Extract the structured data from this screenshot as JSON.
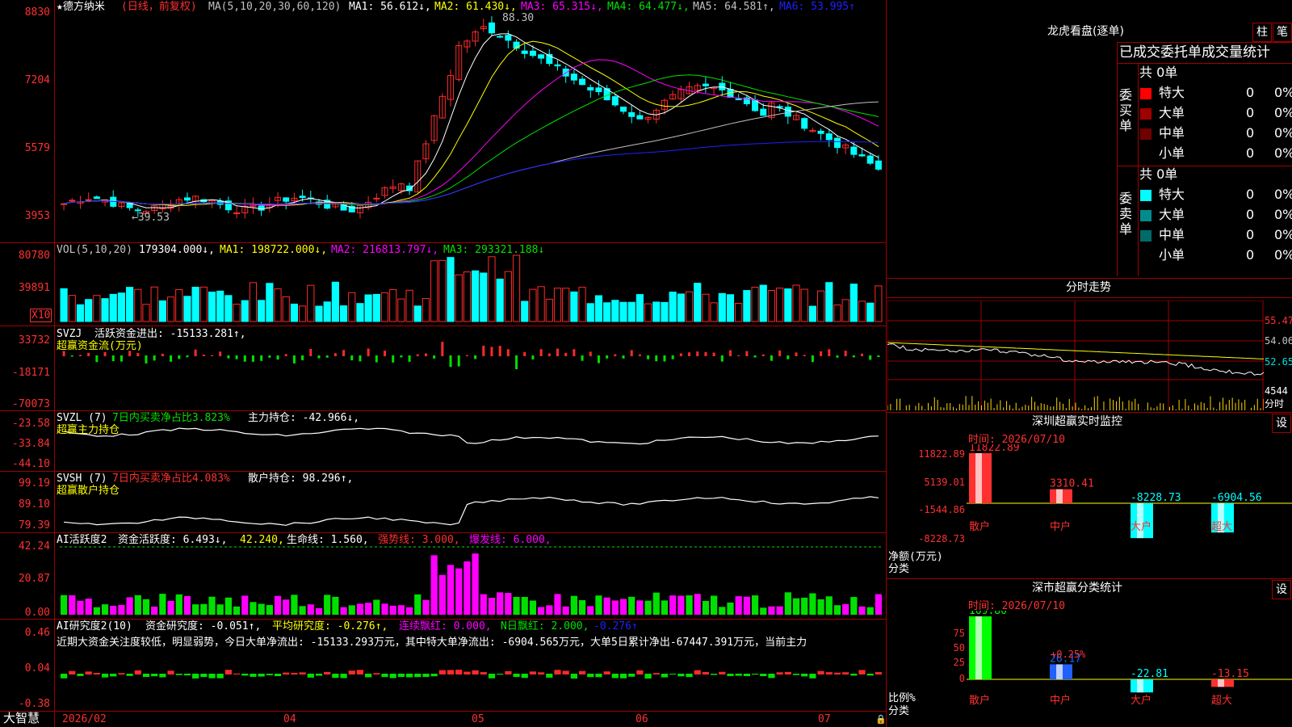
{
  "colors": {
    "up": "#ff2a2a",
    "down": "#00ffff",
    "green": "#00e000",
    "magenta": "#ff00ff",
    "yellow": "#ffff00",
    "white": "#ffffff",
    "blue": "#2020ff",
    "grid": "#a00000"
  },
  "chart": {
    "title": "★德方纳米",
    "period": "(日线，前复权)",
    "ma_label": "MA(5,10,20,30,60,120)",
    "ma1": "MA1: 56.612↓,",
    "ma2": "MA2: 61.430↓,",
    "ma3": "MA3: 65.315↓,",
    "ma4": "MA4: 64.477↓,",
    "ma5": "MA5: 64.581↑,",
    "ma6": "MA6: 53.995↑",
    "max_label": "88.30",
    "min_label": "←39.53",
    "price_ticks": [
      "8830",
      "7204",
      "5579",
      "3953"
    ],
    "vol": {
      "label": "VOL(5,10,20)",
      "v": "179304.000↓,",
      "ma1": "MA1: 198722.000↓,",
      "ma2": "MA2: 216813.797↓,",
      "ma3": "MA3: 293321.188↓",
      "ticks": [
        "80780",
        "39891"
      ],
      "x10": "X10"
    },
    "svzj": {
      "label": "SVZJ",
      "text": "活跃资金进出: -15133.281↑,",
      "sub": "超赢资金流(万元)",
      "ticks": [
        "33732",
        "-18171",
        "-70073"
      ]
    },
    "svzl": {
      "label": "SVZL (7)",
      "pct": "7日内买卖净占比3.823%",
      "hold": "主力持仓: -42.966↓,",
      "sub": "超赢主力持仓",
      "ticks": [
        "-23.58",
        "-33.84",
        "-44.10"
      ]
    },
    "svsh": {
      "label": "SVSH (7)",
      "pct": "7日内买卖净占比4.083%",
      "hold": "散户持仓: 98.296↑,",
      "sub": "超赢散户持仓",
      "ticks": [
        "99.19",
        "89.10",
        "79.39"
      ]
    },
    "ai1": {
      "label": "AI活跃度2",
      "a": "资金活跃度: 6.493↓,",
      "b": "42.240,",
      "c": "生命线: 1.560,",
      "d": "强势线: 3.000,",
      "e": "爆发线: 6.000,",
      "ticks": [
        "42.24",
        "20.87",
        "0.00"
      ]
    },
    "ai2": {
      "label": "AI研究度2(10)",
      "a": "资金研究度: -0.051↑,",
      "b": "平均研究度: -0.276↑,",
      "c": "连续飘红: 0.000,",
      "d": "N日飘红: 2.000,",
      "e": "-0.276↑",
      "note": "近期大资金关注度较低，明显弱势，今日大单净流出: -15133.293万元，其中特大单净流出: -6904.565万元，大单5日累计净出-67447.391万元，当前主力",
      "ticks": [
        "0.46",
        "0.04",
        "-0.38"
      ]
    },
    "dates": [
      "2026/02",
      "04",
      "05",
      "06",
      "07"
    ],
    "brand": "大智慧"
  },
  "lhb": {
    "title": "龙虎看盘(逐单)",
    "btn1": "柱",
    "btn2": "笔",
    "header": "已成交委托单成交量统计",
    "buy": {
      "side": "委买单",
      "total": "共 0单",
      "rows": [
        {
          "name": "特大",
          "n": "0",
          "p": "0%",
          "c": "#ff0000"
        },
        {
          "name": "大单",
          "n": "0",
          "p": "0%",
          "c": "#a00000"
        },
        {
          "name": "中单",
          "n": "0",
          "p": "0%",
          "c": "#700000"
        },
        {
          "name": "小单",
          "n": "0",
          "p": "0%",
          "c": ""
        }
      ]
    },
    "sell": {
      "side": "委卖单",
      "total": "共 0单",
      "rows": [
        {
          "name": "特大",
          "n": "0",
          "p": "0%",
          "c": "#00ffff"
        },
        {
          "name": "大单",
          "n": "0",
          "p": "0%",
          "c": "#008c8c"
        },
        {
          "name": "中单",
          "n": "0",
          "p": "0%",
          "c": "#006a6a"
        },
        {
          "name": "小单",
          "n": "0",
          "p": "0%",
          "c": ""
        }
      ]
    }
  },
  "fenshi": {
    "title": "分时走势",
    "ticks": [
      "55.47",
      "54.06",
      "52.65"
    ],
    "vol": "4544",
    "unit": "分时"
  },
  "szmon": {
    "title": "深圳超赢实时监控",
    "set": "设",
    "date": "时间: 2026/07/10",
    "ticks": [
      "11822.89",
      "5139.01",
      "-1544.86",
      "-8228.73"
    ],
    "ylabel": "净额(万元)",
    "xlabel": "分类",
    "bars": [
      {
        "name": "散户",
        "v": 11822.89,
        "label": "11822.89",
        "c": "#ff3030"
      },
      {
        "name": "中户",
        "v": 3310.41,
        "label": "3310.41",
        "c": "#ff3030"
      },
      {
        "name": "大户",
        "v": -8228.73,
        "label": "-8228.73",
        "c": "#00ffff"
      },
      {
        "name": "超大",
        "v": -6904.56,
        "label": "-6904.56",
        "c": "#00ffff"
      }
    ]
  },
  "szcls": {
    "title": "深市超赢分类统计",
    "set": "设",
    "date": "时间: 2026/07/10",
    "ticks": [
      "75",
      "50",
      "25",
      "0"
    ],
    "ylabel": "比例%",
    "xlabel": "分类",
    "pct": "+0.25%",
    "bars": [
      {
        "name": "散户",
        "v": 109.8,
        "label": "109.80",
        "c": "#00ff00"
      },
      {
        "name": "中户",
        "v": 26.17,
        "label": "26.17",
        "c": "#2060ff"
      },
      {
        "name": "大户",
        "v": -22.81,
        "label": "-22.81",
        "c": "#00ffff"
      },
      {
        "name": "超大",
        "v": -13.15,
        "label": "-13.15",
        "c": "#ff3030"
      }
    ]
  }
}
